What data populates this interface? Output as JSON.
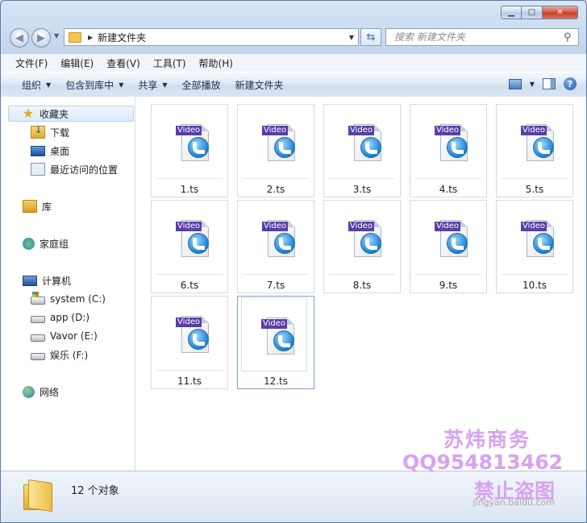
{
  "address": {
    "path": "新建文件夹"
  },
  "search": {
    "placeholder": "搜索 新建文件夹"
  },
  "menu": [
    "文件(F)",
    "编辑(E)",
    "查看(V)",
    "工具(T)",
    "帮助(H)"
  ],
  "commands": {
    "organize": "组织",
    "include_library": "包含到库中",
    "share": "共享",
    "play_all": "全部播放",
    "new_folder": "新建文件夹"
  },
  "nav": {
    "favorites": "收藏夹",
    "downloads": "下载",
    "desktop": "桌面",
    "recent": "最近访问的位置",
    "libraries": "库",
    "homegroup": "家庭组",
    "computer": "计算机",
    "drives": [
      "system (C:)",
      "app (D:)",
      "Vavor (E:)",
      "娱乐 (F:)"
    ],
    "network": "网络"
  },
  "files": [
    {
      "name": "1.ts",
      "badge": "Video"
    },
    {
      "name": "2.ts",
      "badge": "Video"
    },
    {
      "name": "3.ts",
      "badge": "Video"
    },
    {
      "name": "4.ts",
      "badge": "Video"
    },
    {
      "name": "5.ts",
      "badge": "Video"
    },
    {
      "name": "6.ts",
      "badge": "Video"
    },
    {
      "name": "7.ts",
      "badge": "Video"
    },
    {
      "name": "8.ts",
      "badge": "Video"
    },
    {
      "name": "9.ts",
      "badge": "Video"
    },
    {
      "name": "10.ts",
      "badge": "Video"
    },
    {
      "name": "11.ts",
      "badge": "Video"
    },
    {
      "name": "12.ts",
      "badge": "Video"
    }
  ],
  "status": {
    "count": "12 个对象"
  },
  "watermark": {
    "line1": "苏炜商务",
    "line2": "QQ954813462",
    "line3": "禁止盗图",
    "line4": "jingyan.baidu.com"
  }
}
